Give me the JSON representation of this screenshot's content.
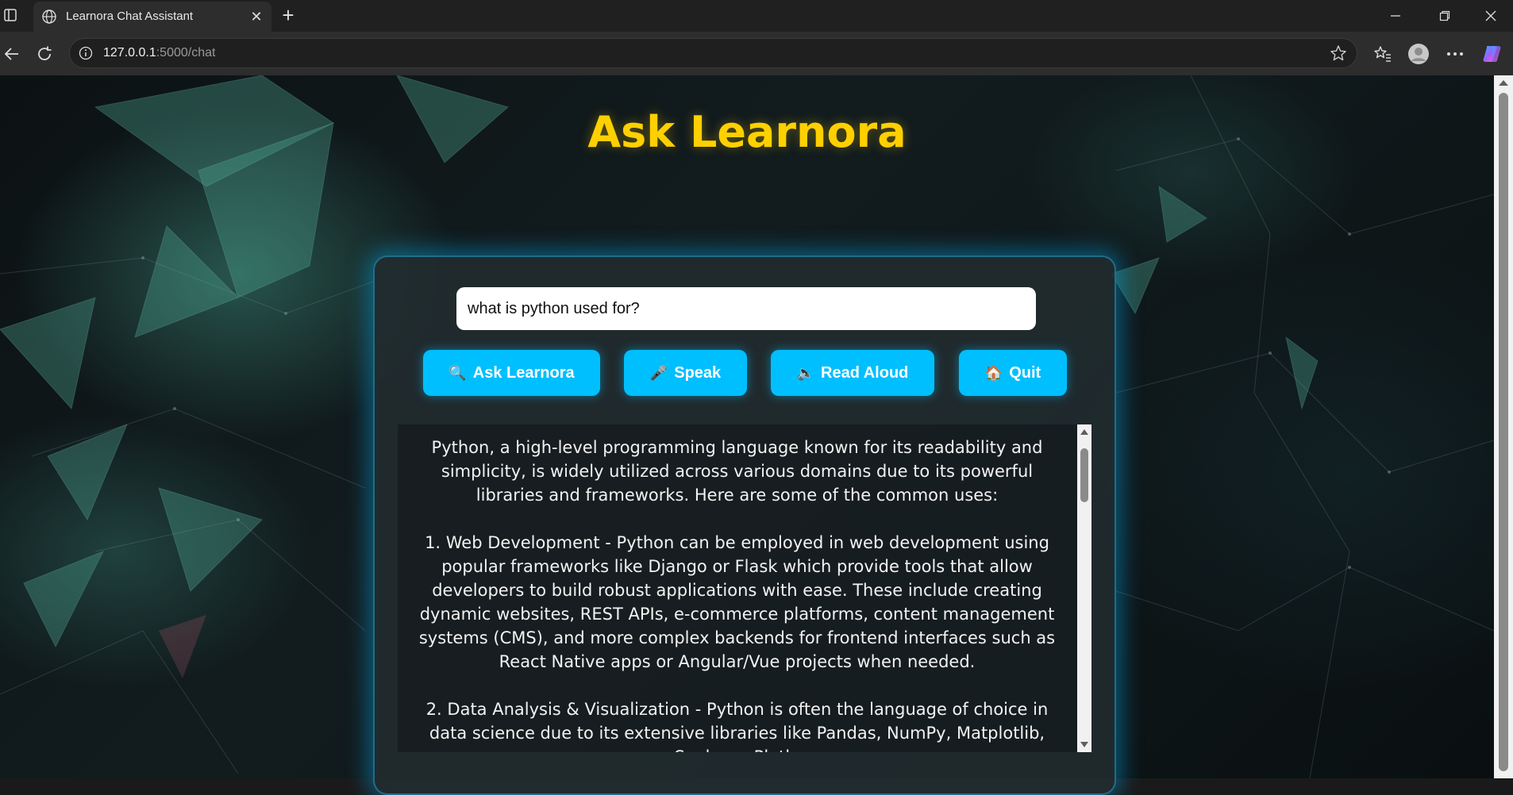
{
  "browser": {
    "tab_title": "Learnora Chat Assistant",
    "url_host": "127.0.0.1",
    "url_path": ":5000/chat",
    "icons": {
      "sidebar": "sidebar-toggle-icon",
      "tab": "globe-icon",
      "close": "close-icon",
      "new_tab": "plus-icon",
      "back": "back-arrow-icon",
      "reload": "reload-icon",
      "info": "info-icon",
      "favorite": "star-icon",
      "favorites": "favorites-icon",
      "profile": "profile-icon",
      "more": "more-icon",
      "copilot": "copilot-icon"
    }
  },
  "app": {
    "title": "Ask Learnora",
    "query_value": "what is python used for?",
    "buttons": {
      "ask": "Ask Learnora",
      "ask_icon": "🔍",
      "speak": "Speak",
      "speak_icon": "🎤",
      "read": "Read Aloud",
      "read_icon": "🔈",
      "quit": "Quit",
      "quit_icon": "🏠"
    },
    "answer": "Python, a high-level programming language known for its readability and simplicity, is widely utilized across various domains due to its powerful libraries and frameworks. Here are some of the common uses:\n\n1. Web Development - Python can be employed in web development using popular frameworks like Django or Flask which provide tools that allow developers to build robust applications with ease. These include creating dynamic websites, REST APIs, e-commerce platforms, content management systems (CMS), and more complex backends for frontend interfaces such as React Native apps or Angular/Vue projects when needed.\n\n2. Data Analysis & Visualization - Python is often the language of choice in data science due to its extensive libraries like Pandas, NumPy, Matplotlib, Seaborn, Plotly",
    "colors": {
      "title": "#ffd000",
      "button": "#00bfff",
      "glow": "#00b4ff"
    }
  }
}
